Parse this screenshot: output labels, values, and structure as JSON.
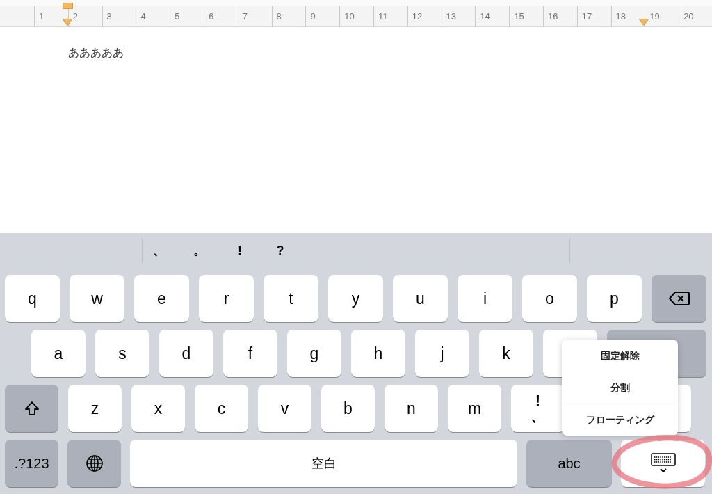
{
  "ruler": {
    "numbers": [
      "1",
      "2",
      "3",
      "4",
      "5",
      "6",
      "7",
      "8",
      "9",
      "10",
      "11",
      "12",
      "13",
      "14",
      "15",
      "16",
      "17",
      "18",
      "19",
      "20"
    ]
  },
  "document": {
    "text": "あああああ"
  },
  "candidates": [
    "、",
    "。",
    "!",
    "?"
  ],
  "keyboard": {
    "rows": [
      [
        {
          "kind": "letter",
          "label": "q"
        },
        {
          "kind": "letter",
          "label": "w"
        },
        {
          "kind": "letter",
          "label": "e"
        },
        {
          "kind": "letter",
          "label": "r"
        },
        {
          "kind": "letter",
          "label": "t"
        },
        {
          "kind": "letter",
          "label": "y"
        },
        {
          "kind": "letter",
          "label": "u"
        },
        {
          "kind": "letter",
          "label": "i"
        },
        {
          "kind": "letter",
          "label": "o"
        },
        {
          "kind": "letter",
          "label": "p"
        },
        {
          "kind": "delete"
        }
      ],
      [
        {
          "kind": "letter",
          "label": "a"
        },
        {
          "kind": "letter",
          "label": "s"
        },
        {
          "kind": "letter",
          "label": "d"
        },
        {
          "kind": "letter",
          "label": "f"
        },
        {
          "kind": "letter",
          "label": "g"
        },
        {
          "kind": "letter",
          "label": "h"
        },
        {
          "kind": "letter",
          "label": "j"
        },
        {
          "kind": "letter",
          "label": "k"
        },
        {
          "kind": "blank"
        },
        {
          "kind": "return"
        }
      ],
      [
        {
          "kind": "shift"
        },
        {
          "kind": "letter",
          "label": "z"
        },
        {
          "kind": "letter",
          "label": "x"
        },
        {
          "kind": "letter",
          "label": "c"
        },
        {
          "kind": "letter",
          "label": "v"
        },
        {
          "kind": "letter",
          "label": "b"
        },
        {
          "kind": "letter",
          "label": "n"
        },
        {
          "kind": "letter",
          "label": "m"
        },
        {
          "kind": "dual",
          "top": "!",
          "bottom": "、"
        },
        {
          "kind": "blank"
        }
      ],
      [
        {
          "kind": "mode",
          "label": ".?123"
        },
        {
          "kind": "globe"
        },
        {
          "kind": "space",
          "label": "空白"
        },
        {
          "kind": "mode",
          "label": "abc"
        },
        {
          "kind": "dismiss"
        }
      ]
    ]
  },
  "menu": {
    "items": [
      "固定解除",
      "分割",
      "フローティング"
    ]
  }
}
